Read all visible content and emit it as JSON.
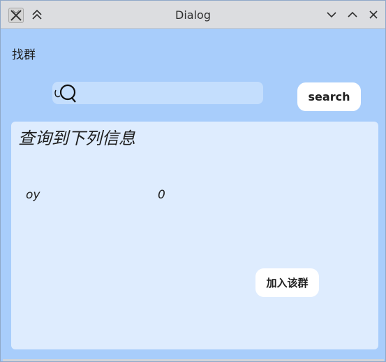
{
  "window": {
    "title": "Dialog",
    "app_icon": "x-app-icon",
    "controls": [
      "keep-above-icon",
      "minimize-icon",
      "maximize-icon",
      "close-icon"
    ]
  },
  "form": {
    "label": "找群",
    "search": {
      "icon": "search-icon",
      "value": "",
      "placeholder": ""
    },
    "search_button": "search"
  },
  "results": {
    "title": "查询到下列信息",
    "group": {
      "name": "oy",
      "count": "0"
    },
    "join_button": "加入该群"
  },
  "colors": {
    "background": "#a8cdfb",
    "panel": "#deecfe",
    "search_field": "#c4defd",
    "button": "#ffffff",
    "titlebar": "#dcdde0"
  }
}
